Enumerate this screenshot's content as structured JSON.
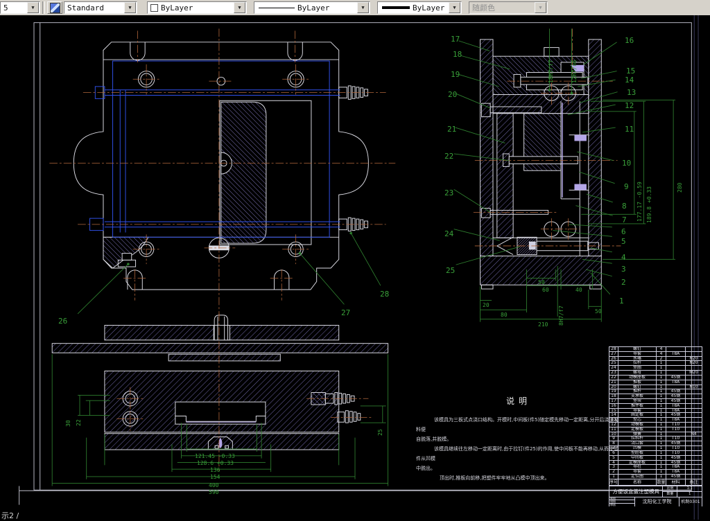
{
  "toolbar": {
    "layer_combo": "5",
    "style_label": "Standard",
    "color_label": "ByLayer",
    "linetype_label": "ByLayer",
    "lineweight_label": "ByLayer",
    "plotstyle_label": "随颜色"
  },
  "status_text": "示2 /",
  "notes": {
    "title": "说明",
    "lines": [
      "该模具为三板式点浇口结构。开模时,中间板(件5)随定模先移动一定距离,分开后浇道凝料便",
      "自脱落,并脱模。",
      "该模具继续往左移动一定距离时,由于拉钉(件25)的作用,使中间板不能再移动,从而使塑件从凹模",
      "中脱出。",
      "顶出时,推板向前移,把塑件牢牢地从凸模中顶出来。"
    ]
  },
  "callouts": {
    "left": [
      "17",
      "18",
      "19",
      "20",
      "21",
      "22",
      "23",
      "24",
      "25"
    ],
    "right": [
      "16",
      "15",
      "14",
      "13",
      "12",
      "11",
      "10",
      "9",
      "8",
      "7",
      "6",
      "5",
      "4",
      "3",
      "2",
      "1"
    ],
    "plan": [
      "26",
      "27",
      "28"
    ]
  },
  "dimensions": {
    "right_view": {
      "fit_top": [
        "18H7/f7",
        "12H7/n6"
      ],
      "vertical": [
        "177.17 -0.59",
        "189.8 +0.33",
        "280"
      ],
      "bottom": [
        "50",
        "60",
        "40",
        "20",
        "80",
        "50",
        "210"
      ],
      "fit_bottom": "8H7/f7"
    },
    "section_view": {
      "horizontal": [
        "121.45 -0.33",
        "128.6 +0.33",
        "136",
        "154",
        "400",
        "590"
      ],
      "left": [
        "30",
        "22"
      ],
      "right": [
        "25"
      ]
    }
  },
  "bom": {
    "headers": [
      "序号",
      "名称",
      "数量",
      "材料",
      "备注"
    ],
    "rows": [
      [
        "28",
        "螺钉",
        "4",
        "",
        ""
      ],
      [
        "27",
        "导套",
        "4",
        "T8A",
        ""
      ],
      [
        "26",
        "水嘴",
        "2",
        "",
        "N20"
      ],
      [
        "25",
        "拉杆",
        "1",
        "",
        "N20"
      ],
      [
        "24",
        "垫圈",
        "1",
        "",
        ""
      ],
      [
        "23",
        "螺母",
        "1",
        "",
        "M20"
      ],
      [
        "22",
        "动模座板",
        "1",
        "45钢",
        ""
      ],
      [
        "21",
        "推板",
        "1",
        "T8A",
        ""
      ],
      [
        "20",
        "螺钉",
        "1",
        "",
        "N10"
      ],
      [
        "19",
        "推杆",
        "1",
        "45钢",
        ""
      ],
      [
        "18",
        "支承板",
        "1",
        "45钢",
        ""
      ],
      [
        "17",
        "垫块",
        "1",
        "45钢",
        ""
      ],
      [
        "16",
        "推件板",
        "1",
        "T8A",
        ""
      ],
      [
        "15",
        "导套",
        "1",
        "T8A",
        ""
      ],
      [
        "14",
        "固定板",
        "1",
        "45钢",
        ""
      ],
      [
        "13",
        "型芯",
        "1",
        "T8A",
        ""
      ],
      [
        "12",
        "动模板",
        "1",
        "T10",
        ""
      ],
      [
        "11",
        "定模板",
        "1",
        "T10",
        ""
      ],
      [
        "10",
        "弹簧",
        "1",
        "",
        "N4"
      ],
      [
        "9",
        "拉料杆",
        "1",
        "T10",
        ""
      ],
      [
        "8",
        "浇口套",
        "1",
        "45钢",
        ""
      ],
      [
        "7",
        "凹模",
        "1",
        "T10",
        ""
      ],
      [
        "6",
        "型腔板",
        "1",
        "T10",
        ""
      ],
      [
        "5",
        "中间板",
        "1",
        "45钢",
        ""
      ],
      [
        "4",
        "定模座板",
        "1",
        "45钢",
        ""
      ],
      [
        "3",
        "导柱",
        "1",
        "T8A",
        ""
      ],
      [
        "2",
        "导套",
        "1",
        "T8A",
        ""
      ],
      [
        "1",
        "定位圈",
        "1",
        "45钢",
        ""
      ]
    ]
  },
  "title_block": {
    "title": "方便饭盒盖注塑模具",
    "scale_label": "比例",
    "scale_value": "1:1",
    "qty_label": "数量",
    "qty_value": "1",
    "cells": [
      "制图",
      "描图",
      "审核"
    ],
    "org": "沈阳化工学院",
    "class_name": "机制0301"
  },
  "colors": {
    "dim_green": "#2e7d2e",
    "centerline_orange": "#b4683c",
    "cooling_blue": "#3050e8",
    "hatch_purple": "#8177c2",
    "outline_white": "#dcdce4"
  }
}
